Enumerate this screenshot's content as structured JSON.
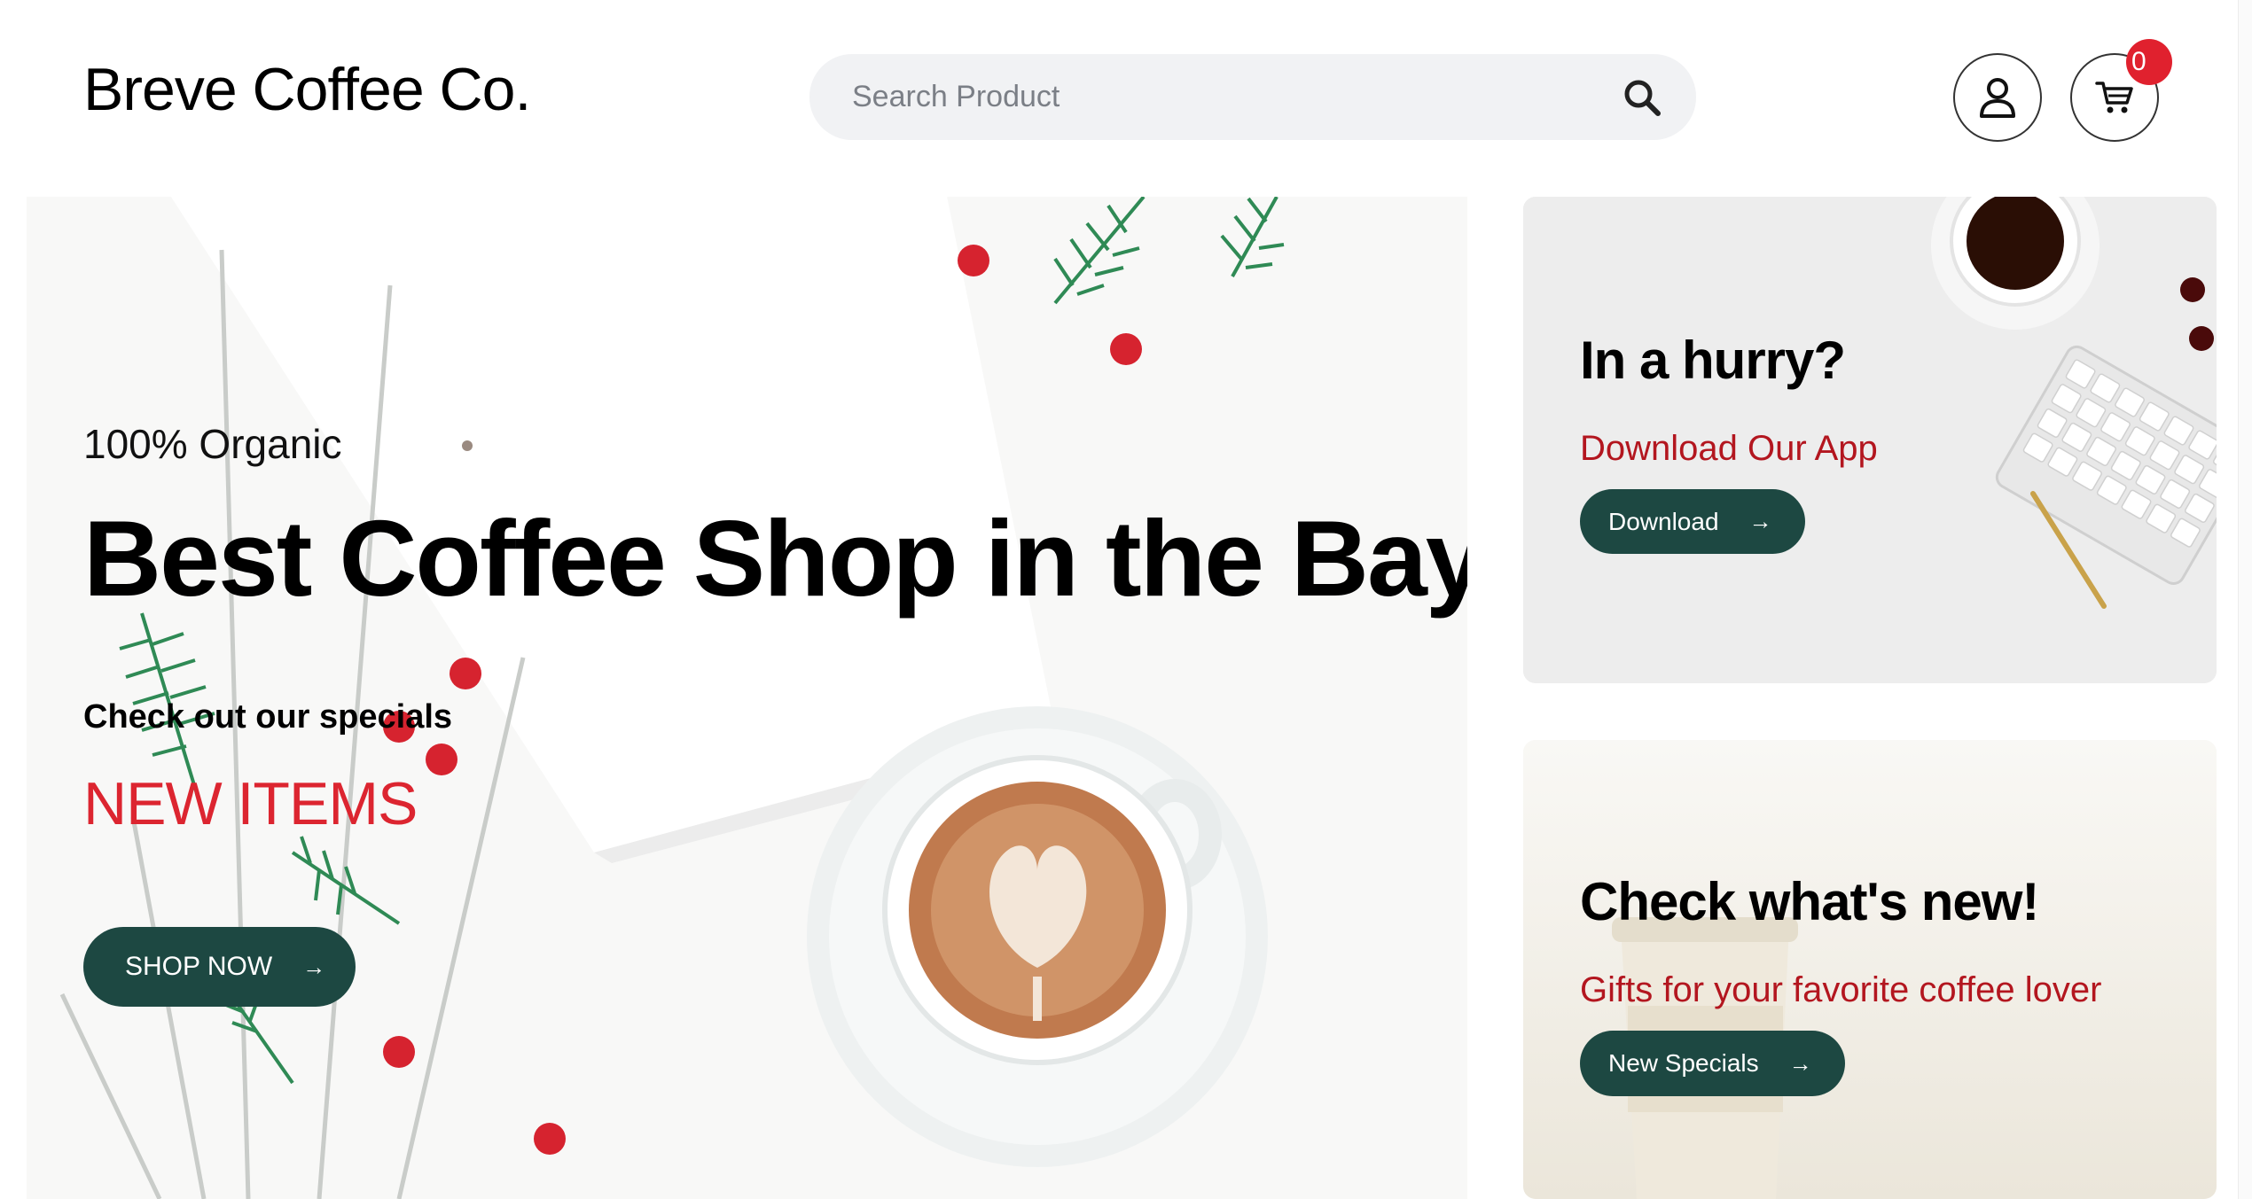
{
  "header": {
    "brand": "Breve Coffee Co.",
    "search_placeholder": "Search Product",
    "cart_count": "0"
  },
  "hero": {
    "kicker": "100% Organic",
    "title": "Best Coffee Shop in the Bay",
    "subtitle": "Check out our specials",
    "highlight": "NEW ITEMS",
    "button_label": "SHOP NOW",
    "button_arrow": "→"
  },
  "cards": [
    {
      "title": "In a hurry?",
      "link": "Download Our App",
      "button_label": "Download",
      "button_arrow": "→"
    },
    {
      "title": "Check what's new!",
      "link": "Gifts for your favorite coffee lover",
      "button_label": "New Specials",
      "button_arrow": "→"
    }
  ],
  "colors": {
    "accent_dark_green": "#1d4842",
    "accent_red": "#dc2530",
    "link_red": "#b3161f",
    "search_bg": "#f1f2f4",
    "badge_red": "#e0212e"
  },
  "icons": [
    "search-icon",
    "user-icon",
    "cart-icon",
    "arrow-right-icon"
  ]
}
